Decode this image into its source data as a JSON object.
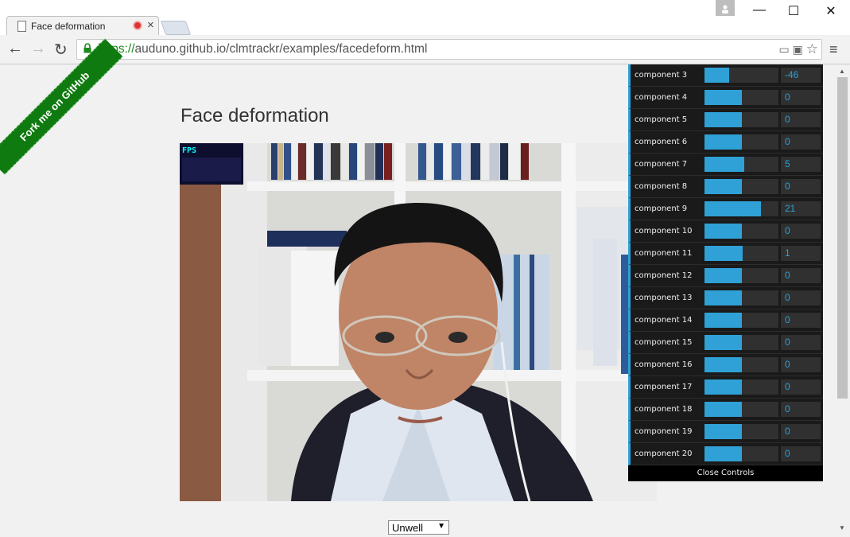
{
  "tab": {
    "title": "Face deformation"
  },
  "window": {
    "minimize": "—",
    "maximize": "☐",
    "close": "✕"
  },
  "toolbar": {
    "url_scheme": "https://",
    "url_rest": "auduno.github.io/clmtrackr/examples/facedeform.html"
  },
  "ribbon": {
    "text": "Fork me on GitHub"
  },
  "page": {
    "heading": "Face deformation"
  },
  "stats": {
    "label": "FPS"
  },
  "gui": {
    "components": [
      {
        "name": "component 3",
        "value": "-46",
        "fill": 0.33
      },
      {
        "name": "component 4",
        "value": "0",
        "fill": 0.5
      },
      {
        "name": "component 5",
        "value": "0",
        "fill": 0.5
      },
      {
        "name": "component 6",
        "value": "0",
        "fill": 0.5
      },
      {
        "name": "component 7",
        "value": "5",
        "fill": 0.54
      },
      {
        "name": "component 8",
        "value": "0",
        "fill": 0.5
      },
      {
        "name": "component 9",
        "value": "21",
        "fill": 0.76
      },
      {
        "name": "component 10",
        "value": "0",
        "fill": 0.5
      },
      {
        "name": "component 11",
        "value": "1",
        "fill": 0.52
      },
      {
        "name": "component 12",
        "value": "0",
        "fill": 0.5
      },
      {
        "name": "component 13",
        "value": "0",
        "fill": 0.5
      },
      {
        "name": "component 14",
        "value": "0",
        "fill": 0.5
      },
      {
        "name": "component 15",
        "value": "0",
        "fill": 0.5
      },
      {
        "name": "component 16",
        "value": "0",
        "fill": 0.5
      },
      {
        "name": "component 17",
        "value": "0",
        "fill": 0.5
      },
      {
        "name": "component 18",
        "value": "0",
        "fill": 0.5
      },
      {
        "name": "component 19",
        "value": "0",
        "fill": 0.5
      },
      {
        "name": "component 20",
        "value": "0",
        "fill": 0.5
      }
    ],
    "close_label": "Close Controls"
  },
  "select": {
    "value": "Unwell"
  },
  "colors": {
    "accent": "#2fa1d6",
    "ribbon": "#0f7a0f",
    "url_scheme": "#1a8a1a"
  }
}
